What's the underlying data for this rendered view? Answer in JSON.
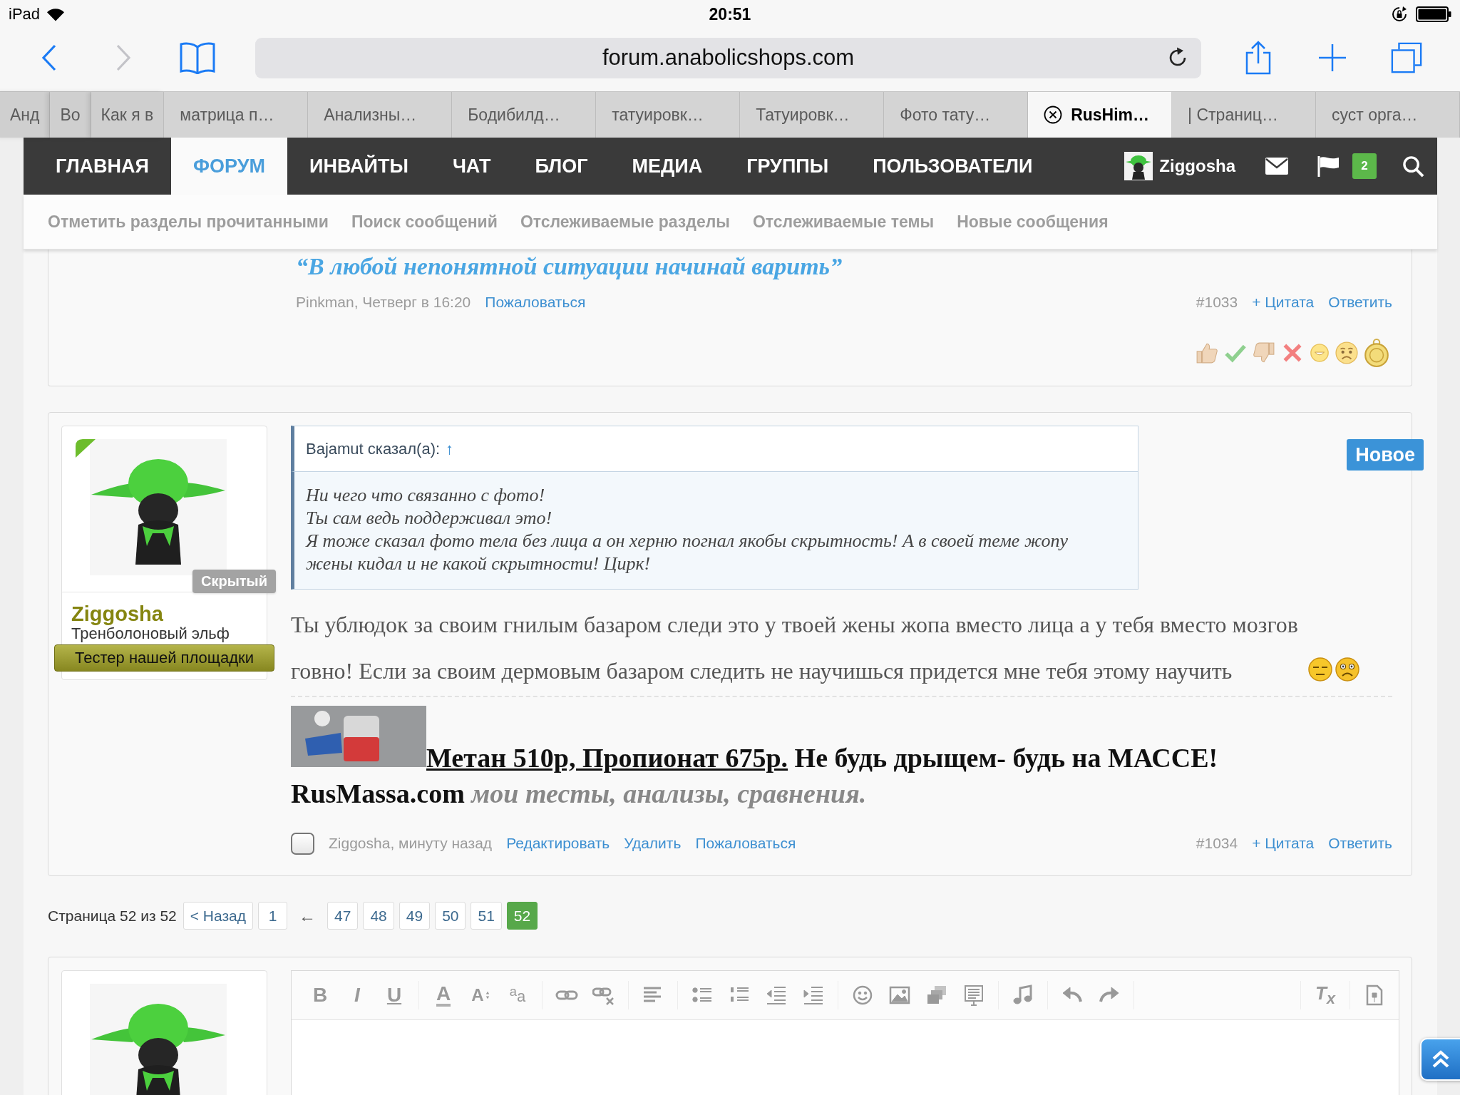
{
  "status_bar": {
    "device": "iPad",
    "time": "20:51"
  },
  "browser": {
    "nav_buttons": [
      {
        "kind": "back",
        "disabled": false
      },
      {
        "kind": "forward",
        "disabled": true
      }
    ],
    "url": "forum.anabolicshops.com",
    "tabs": [
      {
        "kind": "stacked",
        "label": "Анд",
        "selected": false
      },
      {
        "kind": "stacked",
        "label": "Во",
        "selected": false
      },
      {
        "kind": "stacked",
        "label": "Как я в",
        "selected": false
      },
      {
        "kind": "full",
        "label": "матрица п…",
        "selected": false
      },
      {
        "kind": "full",
        "label": "Анализны…",
        "selected": false
      },
      {
        "kind": "full",
        "label": "Бодибилд…",
        "selected": false
      },
      {
        "kind": "full",
        "label": "татуировк…",
        "selected": false
      },
      {
        "kind": "full",
        "label": "Татуировк…",
        "selected": false
      },
      {
        "kind": "full",
        "label": "Фото тату…",
        "selected": false
      },
      {
        "kind": "full",
        "label": "RusHim…",
        "selected": true
      },
      {
        "kind": "full",
        "label": "| Страниц…",
        "selected": false
      },
      {
        "kind": "full",
        "label": "суст орга…",
        "selected": false
      }
    ]
  },
  "site_nav": {
    "items": [
      {
        "label": "ГЛАВНАЯ",
        "selected": false
      },
      {
        "label": "ФОРУМ",
        "selected": true
      },
      {
        "label": "ИНВАЙТЫ",
        "selected": false
      },
      {
        "label": "ЧАТ",
        "selected": false
      },
      {
        "label": "БЛОГ",
        "selected": false
      },
      {
        "label": "МЕДИА",
        "selected": false
      },
      {
        "label": "ГРУППЫ",
        "selected": false
      },
      {
        "label": "ПОЛЬЗОВАТЕЛИ",
        "selected": false
      }
    ],
    "user": "Ziggosha",
    "alerts_count": "2"
  },
  "sub_nav": [
    "Отметить разделы прочитанными",
    "Поиск сообщений",
    "Отслеживаемые разделы",
    "Отслеживаемые темы",
    "Новые сообщения"
  ],
  "posts": [
    {
      "signature_text": "“В любой непонятной ситуации начинай варить”",
      "meta": {
        "author": "Pinkman, Четверг в 16:20",
        "links": [
          "Пожаловаться"
        ],
        "number": "#1033",
        "actions": [
          "+ Цитата",
          "Ответить"
        ]
      },
      "reactions": true
    },
    {
      "user": {
        "name": "Ziggosha",
        "title": "Тренболоновый эльф",
        "rank": "Тестер нашей площадки",
        "visibility": "Скрытый",
        "online": true
      },
      "new_label": "Новое",
      "quote": {
        "author": "Bajamut сказал(а):",
        "jump": "↑",
        "lines": [
          "Ни чего что связанно с фото!",
          "Ты сам ведь поддерживал это!",
          "Я тоже сказал фото тела без лица а он херню погнал якобы скрытность! А в своей теме жопу жены кидал и не какой скрытности! Цирк!"
        ]
      },
      "message": "Ты ублюдок за своим гнилым базаром следи это у твоей жены жопа вместо лица а у тебя вместо мозгов говно! Если за своим дермовым базаром следить не научишься придется мне тебя этому научить",
      "signature": {
        "link": "Метан 510р, Пропионат 675р.",
        "slogan": "Не будь дрыщем- будь на МАССЕ!",
        "site": "RusMassa.com",
        "tagline": "мои тесты, анализы, сравнения."
      },
      "meta": {
        "checked": false,
        "author": "Ziggosha, минуту назад",
        "links": [
          "Редактировать",
          "Удалить",
          "Пожаловаться"
        ],
        "number": "#1034",
        "actions": [
          "+ Цитата",
          "Ответить"
        ]
      }
    }
  ],
  "pagination": {
    "label": "Страница 52 из 52",
    "prev": "< Назад",
    "items": [
      {
        "kind": "page",
        "label": "1",
        "selected": false
      },
      {
        "kind": "skip",
        "label": "←",
        "selected": false
      },
      {
        "kind": "page",
        "label": "47",
        "selected": false
      },
      {
        "kind": "page",
        "label": "48",
        "selected": false
      },
      {
        "kind": "page",
        "label": "49",
        "selected": false
      },
      {
        "kind": "page",
        "label": "50",
        "selected": false
      },
      {
        "kind": "page",
        "label": "51",
        "selected": false
      },
      {
        "kind": "page",
        "label": "52",
        "selected": true
      }
    ]
  },
  "reply_editor": {
    "toolbar_groups": [
      {
        "items": [
          {
            "kind": "bold",
            "label": "B"
          },
          {
            "kind": "italic",
            "label": "I"
          },
          {
            "kind": "underline",
            "label": "U"
          }
        ]
      },
      {
        "items": [
          {
            "kind": "color",
            "label": "A"
          },
          {
            "kind": "size",
            "label": "A"
          },
          {
            "kind": "case",
            "label": "$^{a}$a"
          }
        ]
      },
      {
        "items": [
          {
            "kind": "link"
          },
          {
            "kind": "unlink"
          }
        ]
      },
      {
        "items": [
          {
            "kind": "align"
          }
        ]
      },
      {
        "items": [
          {
            "kind": "bullets"
          },
          {
            "kind": "numbers"
          },
          {
            "kind": "outdent"
          },
          {
            "kind": "indent"
          }
        ]
      },
      {
        "items": [
          {
            "kind": "smiley"
          },
          {
            "kind": "image"
          },
          {
            "kind": "media"
          },
          {
            "kind": "template"
          }
        ]
      },
      {
        "items": [
          {
            "kind": "music"
          }
        ]
      },
      {
        "items": [
          {
            "kind": "undo"
          },
          {
            "kind": "redo"
          }
        ]
      },
      {
        "items": [
          {
            "kind": "clear",
            "label": "T$_{x}$"
          }
        ]
      },
      {
        "items": [
          {
            "kind": "draft"
          }
        ]
      }
    ]
  }
}
